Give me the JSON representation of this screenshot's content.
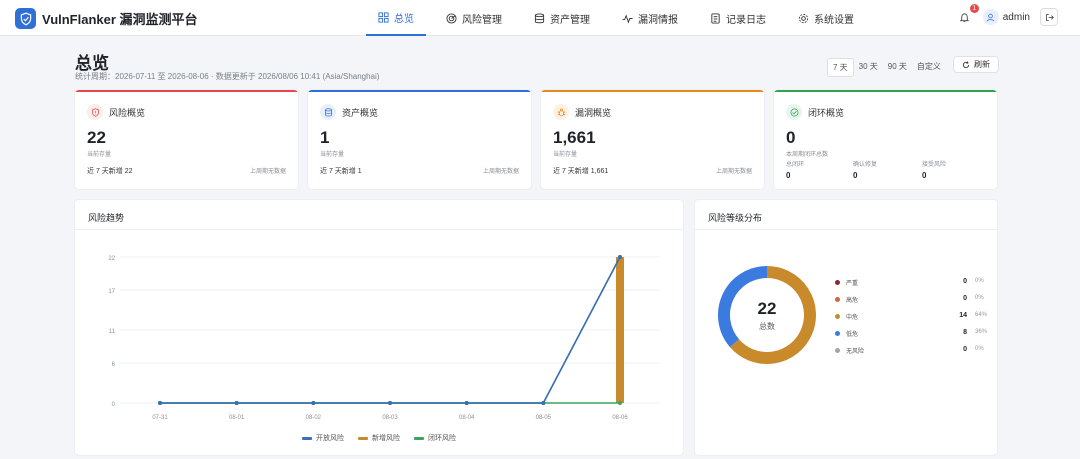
{
  "brand": {
    "name": "VulnFlanker 漏洞监测平台"
  },
  "nav": [
    {
      "label": "总览",
      "icon": "grid-icon",
      "active": true
    },
    {
      "label": "风险管理",
      "icon": "radar-icon",
      "active": false
    },
    {
      "label": "资产管理",
      "icon": "database-icon",
      "active": false
    },
    {
      "label": "漏洞情报",
      "icon": "pulse-icon",
      "active": false
    },
    {
      "label": "记录日志",
      "icon": "log-icon",
      "active": false
    },
    {
      "label": "系统设置",
      "icon": "gear-icon",
      "active": false
    }
  ],
  "header_tools": {
    "notification_count": "1",
    "user": "admin"
  },
  "page": {
    "title": "总览",
    "subtitle": "统计周期：2026-07-11 至 2026-08-06 · 数据更新于 2026/08/06 10:41 (Asia/Shanghai)"
  },
  "range_tabs": [
    {
      "label": "7 天",
      "active": true
    },
    {
      "label": "30 天",
      "active": false
    },
    {
      "label": "90 天",
      "active": false
    },
    {
      "label": "自定义",
      "active": false
    }
  ],
  "refresh_label": "刷新",
  "cards": {
    "risk": {
      "title": "风险概览",
      "value": "22",
      "caption": "当前存量",
      "foot_left": "近 7 天新增 22",
      "foot_right": "上周期无数据",
      "color": "#e5484d"
    },
    "asset": {
      "title": "资产概览",
      "value": "1",
      "caption": "当前存量",
      "foot_left": "近 7 天新增 1",
      "foot_right": "上周期无数据",
      "color": "#2f6fd6"
    },
    "vuln": {
      "title": "漏洞概览",
      "value": "1,661",
      "caption": "当前存量",
      "foot_left": "近 7 天新增 1,661",
      "foot_right": "上周期无数据",
      "color": "#e8891c"
    },
    "closed": {
      "title": "闭环概览",
      "value": "0",
      "caption": "本周期闭环总数",
      "cols": [
        {
          "label": "总闭环",
          "value": "0"
        },
        {
          "label": "确认修复",
          "value": "0"
        },
        {
          "label": "接受风险",
          "value": "0"
        }
      ],
      "color": "#2fa34f"
    }
  },
  "trend": {
    "title": "风险趋势",
    "legend": [
      {
        "label": "开放风险",
        "color": "#3b6fb6"
      },
      {
        "label": "新增风险",
        "color": "#c98a2b"
      },
      {
        "label": "闭环风险",
        "color": "#3aa55b"
      }
    ]
  },
  "distribution": {
    "title": "风险等级分布",
    "total": "22",
    "total_label": "总数",
    "items": [
      {
        "name": "严重",
        "count": "0",
        "pct": "0%",
        "color": "#8a2b2b"
      },
      {
        "name": "高危",
        "count": "0",
        "pct": "0%",
        "color": "#d9623b"
      },
      {
        "name": "中危",
        "count": "14",
        "pct": "64%",
        "color": "#c98a2b"
      },
      {
        "name": "低危",
        "count": "8",
        "pct": "36%",
        "color": "#3b7be0"
      },
      {
        "name": "无风险",
        "count": "0",
        "pct": "0%",
        "color": "#a0a5ad"
      }
    ]
  },
  "chart_data": {
    "type": "line",
    "x": [
      "07-31",
      "08-01",
      "08-02",
      "08-03",
      "08-04",
      "08-05",
      "08-06"
    ],
    "series": [
      {
        "name": "开放风险",
        "kind": "line",
        "values": [
          0,
          0,
          0,
          0,
          0,
          0,
          22
        ]
      },
      {
        "name": "新增风险",
        "kind": "bar",
        "values": [
          0,
          0,
          0,
          0,
          0,
          0,
          22
        ]
      },
      {
        "name": "闭环风险",
        "kind": "line",
        "values": [
          0,
          0,
          0,
          0,
          0,
          0,
          0
        ]
      }
    ],
    "yticks": [
      0,
      6,
      11,
      17,
      22
    ],
    "ylim": [
      0,
      22
    ],
    "legend_position": "bottom"
  }
}
